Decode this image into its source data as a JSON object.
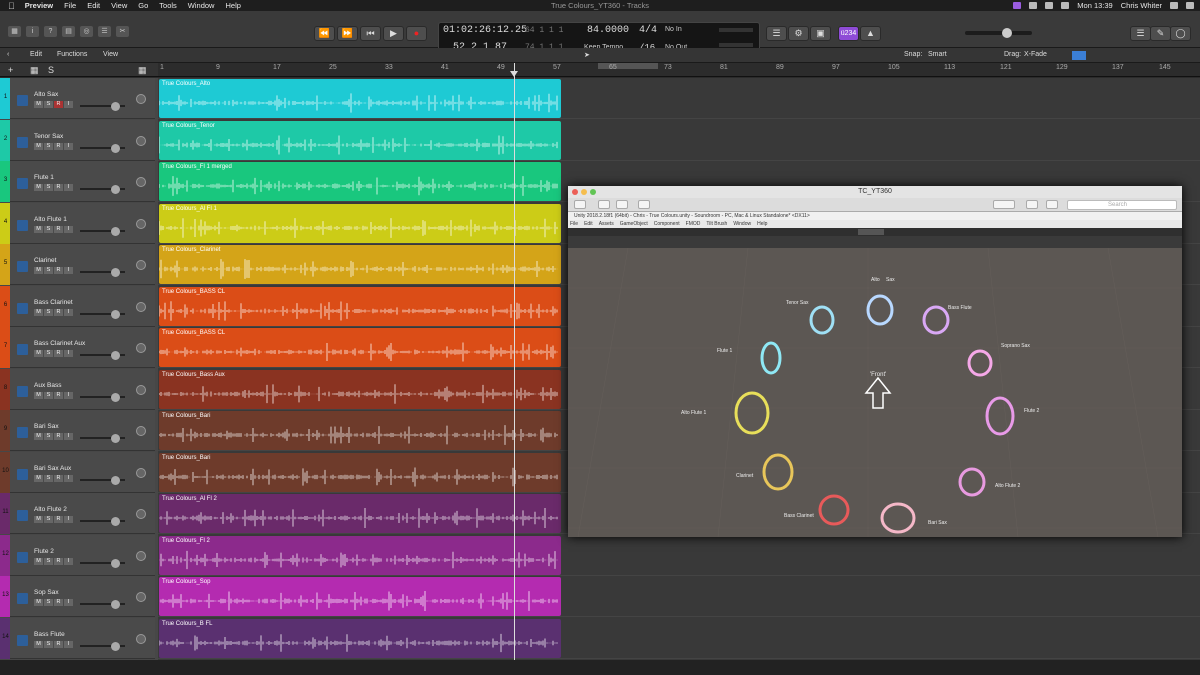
{
  "menubar": {
    "app": "Preview",
    "items": [
      "File",
      "Edit",
      "View",
      "Go",
      "Tools",
      "Window",
      "Help"
    ],
    "center_title": "True Colours_YT360 - Tracks",
    "clock": "Mon 13:39",
    "user": "Chris Whiter"
  },
  "lcd": {
    "time": "01:02:26:12.25",
    "bars": "52  2  1    87",
    "sub1": "64  1  1  1",
    "sub2": "74  1  1  1",
    "tempo": "84.0000",
    "tempo_mode": "Keep Tempo",
    "sig_top": "4/4",
    "sig_bottom": "/16",
    "in": "No In",
    "out": "No Out",
    "tag": "ü234"
  },
  "toolbar2": {
    "edit": "Edit",
    "functions": "Functions",
    "view": "View",
    "snap_label": "Snap:",
    "snap_value": "Smart",
    "drag_label": "Drag:",
    "drag_value": "X-Fade"
  },
  "ruler": [
    "1",
    "9",
    "17",
    "25",
    "33",
    "41",
    "49",
    "57",
    "65",
    "73",
    "81",
    "89",
    "97",
    "105",
    "113",
    "121",
    "129",
    "137",
    "145"
  ],
  "tracks": [
    {
      "num": "1",
      "name": "Alto Sax",
      "region": "True Colours_Alto",
      "color": "#1ecad4"
    },
    {
      "num": "2",
      "name": "Tenor Sax",
      "region": "True Colours_Tenor",
      "color": "#1ec9a7"
    },
    {
      "num": "3",
      "name": "Flute 1",
      "region": "True Colours_Fl 1 merged",
      "color": "#19c77e"
    },
    {
      "num": "4",
      "name": "Alto Flute 1",
      "region": "True Colours_Al Fl 1",
      "color": "#cccc17"
    },
    {
      "num": "5",
      "name": "Clarinet",
      "region": "True Colours_Clarinet",
      "color": "#d4a418"
    },
    {
      "num": "6",
      "name": "Bass Clarinet",
      "region": "True Colours_BASS CL",
      "color": "#db4d17"
    },
    {
      "num": "7",
      "name": "Bass Clarinet Aux",
      "region": "True Colours_BASS CL",
      "color": "#db4d17"
    },
    {
      "num": "8",
      "name": "Aux Bass",
      "region": "True Colours_Bass Aux",
      "color": "#8a3321"
    },
    {
      "num": "9",
      "name": "Bari Sax",
      "region": "True Colours_Bari",
      "color": "#6e3b2b"
    },
    {
      "num": "10",
      "name": "Bari Sax Aux",
      "region": "True Colours_Bari",
      "color": "#6e3b2b"
    },
    {
      "num": "11",
      "name": "Alto Flute 2",
      "region": "True Colours_Al Fl 2",
      "color": "#6a2a6a"
    },
    {
      "num": "12",
      "name": "Flute 2",
      "region": "True Colours_Fl 2",
      "color": "#8c2a8c"
    },
    {
      "num": "13",
      "name": "Sop Sax",
      "region": "True Colours_Sop",
      "color": "#b42bb0"
    },
    {
      "num": "14",
      "name": "Bass Flute",
      "region": "True Colours_B FL",
      "color": "#5a3070"
    }
  ],
  "overlay": {
    "title": "TC_YT360",
    "search": "Search",
    "unity_title": "Unity 2018.2.18f1 (64bit) - Chris - True Colours.unity - Soundroom - PC, Mac & Linux Standalone* <DX11>",
    "unity_menu": [
      "File",
      "Edit",
      "Assets",
      "GameObject",
      "Component",
      "FMOD",
      "Tilt Brush",
      "Window",
      "Help"
    ],
    "front_label": "'Front'",
    "instruments": [
      "Alto",
      "Sax",
      "Tenor Sax",
      "Bass Flute",
      "Soprano Sax",
      "Flute 1",
      "Alto Flute 1",
      "Flute 2",
      "Clarinet",
      "Alto Flute 2",
      "Bass Clarinet",
      "Bari Sax"
    ]
  }
}
